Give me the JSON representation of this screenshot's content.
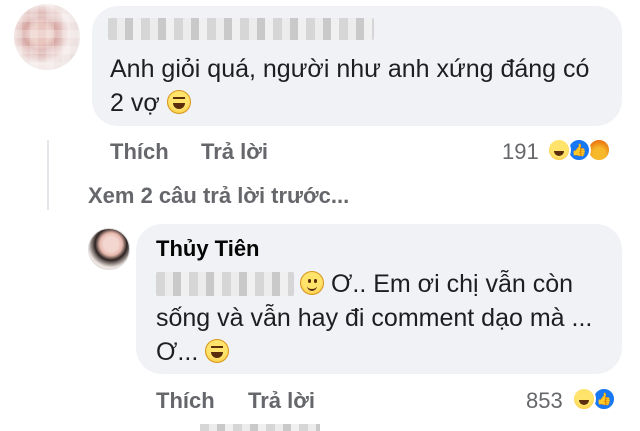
{
  "comment1": {
    "text": "Anh giỏi quá, người như anh xứng đáng có 2 vợ",
    "actions": {
      "like": "Thích",
      "reply": "Trả lời"
    },
    "reaction_count": "191",
    "reactions": [
      "haha",
      "like",
      "angry"
    ]
  },
  "view_more": "Xem 2 câu trả lời trước...",
  "reply": {
    "author": "Thủy Tiên",
    "text_part1": "Ơ.. Em ơi chị vẫn còn sống và vẫn hay đi comment dạo mà ... Ơ...",
    "actions": {
      "like": "Thích",
      "reply": "Trả lời"
    },
    "reaction_count": "853",
    "reactions": [
      "haha",
      "like"
    ]
  },
  "colors": {
    "bubble": "#f0f2f5",
    "secondary_text": "#65676b",
    "like_blue": "#1877f2"
  }
}
